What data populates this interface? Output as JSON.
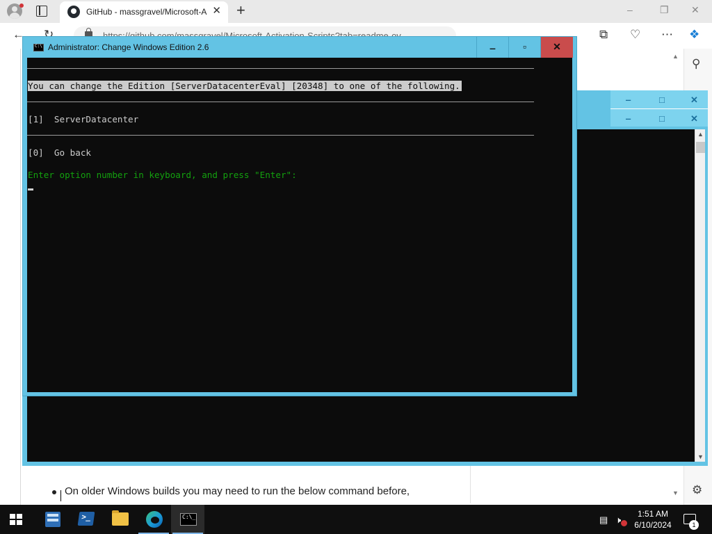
{
  "browser": {
    "tab_title": "GitHub - massgravel/Microsoft-A",
    "tab_close": "✕",
    "new_tab": "+",
    "address": "https://github.com/massgravel/Microsoft-Activation-Scripts?tab=readme-ov",
    "icons": [
      "profile-icon",
      "tab-actions-icon",
      "github-icon",
      "back-icon",
      "refresh-icon",
      "lock-icon",
      "read-aloud-icon",
      "favorite-icon",
      "split-screen-icon",
      "favorites-icon",
      "collections-icon",
      "browser-essentials-icon",
      "more-icon",
      "copilot-icon"
    ]
  },
  "page": {
    "bullet_text": "On older Windows builds you may need to run the below command before,"
  },
  "bg_windows": {
    "buttons": {
      "min": "‒",
      "max": "□",
      "close": "✕"
    }
  },
  "console_window": {
    "title": "Administrator:  Change Windows Edition 2.6",
    "buttons": {
      "min": "‒",
      "max": "▫",
      "close": "✕"
    },
    "lines": {
      "header": "You can change the Edition [ServerDatacenterEval] [20348] to one of the following.",
      "option1": "[1]  ServerDatacenter",
      "option0": "[0]  Go back",
      "prompt": "Enter option number in keyboard, and press \"Enter\":"
    }
  },
  "taskbar": {
    "apps": [
      "server-manager",
      "powershell",
      "file-explorer",
      "edge",
      "command-prompt"
    ],
    "active_app": "command-prompt",
    "time": "1:51 AM",
    "date": "6/10/2024",
    "notification_count": "1"
  },
  "colors": {
    "console_bg": "#0c0c0c",
    "console_text": "#cccccc",
    "prompt_green": "#13a10e",
    "window_frame": "#63c3e4",
    "close_red": "#c94c4c"
  }
}
